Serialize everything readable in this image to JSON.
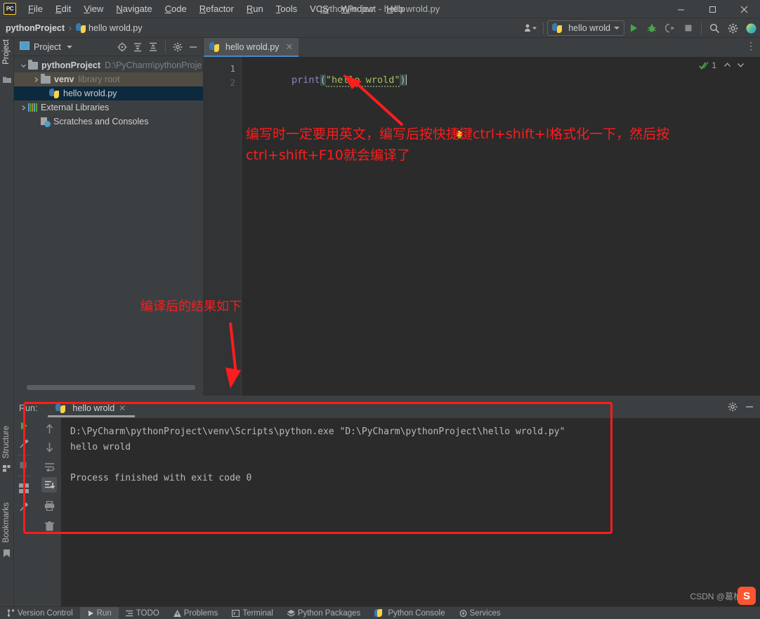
{
  "window": {
    "title": "pythonProject - hello wrold.py",
    "logo_text": "PC",
    "minimize": "—",
    "maximize": "☐",
    "close": "✕"
  },
  "menubar": {
    "items": [
      {
        "label": "File",
        "mnemonic": "F"
      },
      {
        "label": "Edit",
        "mnemonic": "E"
      },
      {
        "label": "View",
        "mnemonic": "V"
      },
      {
        "label": "Navigate",
        "mnemonic": "N"
      },
      {
        "label": "Code",
        "mnemonic": "C"
      },
      {
        "label": "Refactor",
        "mnemonic": "R"
      },
      {
        "label": "Run",
        "mnemonic": "R"
      },
      {
        "label": "Tools",
        "mnemonic": "T"
      },
      {
        "label": "VCS",
        "mnemonic": "S"
      },
      {
        "label": "Window",
        "mnemonic": "W"
      },
      {
        "label": "Help",
        "mnemonic": "H"
      }
    ]
  },
  "navbar": {
    "breadcrumb": [
      {
        "label": "pythonProject",
        "bold": true
      },
      {
        "label": "hello wrold.py",
        "bold": false
      }
    ],
    "separator": "›",
    "run_config": "hello wrold",
    "buttons": [
      {
        "name": "run-button",
        "title": "Run"
      },
      {
        "name": "debug-button",
        "title": "Debug"
      },
      {
        "name": "coverage-button",
        "title": "Run with Coverage"
      },
      {
        "name": "stop-button",
        "title": "Stop"
      },
      {
        "name": "search-everywhere-icon",
        "title": "Search Everywhere"
      },
      {
        "name": "settings-gear-icon",
        "title": "Settings"
      }
    ]
  },
  "left_strip": {
    "project_tab": "Project",
    "structure_tab": "Structure",
    "bookmarks_tab": "Bookmarks"
  },
  "project_panel": {
    "title": "Project",
    "tools": [
      "locate-icon",
      "expand-all-icon",
      "collapse-all-icon",
      "settings-gear-icon",
      "hide-icon"
    ],
    "tree": [
      {
        "label": "pythonProject",
        "sub": "D:\\PyCharm\\pythonProje",
        "indent": 0,
        "arrow": "⌄",
        "icon": "folder",
        "bold": true,
        "state": "none"
      },
      {
        "label": "venv",
        "sub": "library root",
        "indent": 1,
        "arrow": "›",
        "icon": "folder",
        "bold": false,
        "state": "venv"
      },
      {
        "label": "hello wrold.py",
        "sub": "",
        "indent": 2,
        "arrow": "",
        "icon": "python",
        "bold": false,
        "state": "file"
      },
      {
        "label": "External Libraries",
        "sub": "",
        "indent": 0,
        "arrow": "›",
        "icon": "libs",
        "bold": false,
        "state": "none"
      },
      {
        "label": "Scratches and Consoles",
        "sub": "",
        "indent": 1,
        "arrow": "",
        "icon": "scratch",
        "bold": false,
        "state": "none"
      }
    ]
  },
  "editor": {
    "tab_label": "hello wrold.py",
    "tab_close": "✕",
    "more_icon": "⋮",
    "line_numbers": [
      "1",
      "2"
    ],
    "code": {
      "fn": "print",
      "open_paren": "(",
      "string": "\"hello wrold\"",
      "close_paren": ")"
    },
    "inspection_count": "1",
    "inspection_up": "⌃",
    "inspection_down": "⌄"
  },
  "annotations": {
    "note1": "编写时一定要用英文，编写后按快捷键ctrl+shift+l格式化一下，然后按ctrl+shift+F10就会编译了",
    "note2": "编译后的结果如下"
  },
  "run_panel": {
    "label": "Run:",
    "tab_label": "hello wrold",
    "tab_close": "✕",
    "header_buttons": [
      "settings-gear-icon",
      "hide-icon"
    ],
    "console_tools": [
      "scroll-up-icon",
      "scroll-down-icon",
      "soft-wrap-icon",
      "scroll-to-end-icon",
      "print-icon",
      "trash-icon"
    ],
    "console_lines": [
      "D:\\PyCharm\\pythonProject\\venv\\Scripts\\python.exe \"D:\\PyCharm\\pythonProject\\hello wrold.py\"",
      "hello wrold",
      "",
      "Process finished with exit code 0"
    ]
  },
  "statusbar": {
    "items": [
      {
        "label": "Version Control",
        "icon": "branch-icon",
        "active": false
      },
      {
        "label": "Run",
        "icon": "play-icon",
        "active": true
      },
      {
        "label": "TODO",
        "icon": "list-icon",
        "active": false
      },
      {
        "label": "Problems",
        "icon": "warning-icon",
        "active": false
      },
      {
        "label": "Terminal",
        "icon": "terminal-icon",
        "active": false
      },
      {
        "label": "Python Packages",
        "icon": "package-icon",
        "active": false
      },
      {
        "label": "Python Console",
        "icon": "python-icon",
        "active": false
      },
      {
        "label": "Services",
        "icon": "services-icon",
        "active": false
      }
    ]
  },
  "watermark": {
    "text": "CSDN @葛柚",
    "logo": "S"
  },
  "colors": {
    "accent_red": "#fc1d1d",
    "chrome": "#3c3f41",
    "editor_bg": "#2b2b2b",
    "tab_underline": "#4a88c7",
    "selection_blue": "#0d293e",
    "string_green": "#a5c261",
    "keyword_purple": "#8888c6",
    "run_green": "#5ea329"
  }
}
